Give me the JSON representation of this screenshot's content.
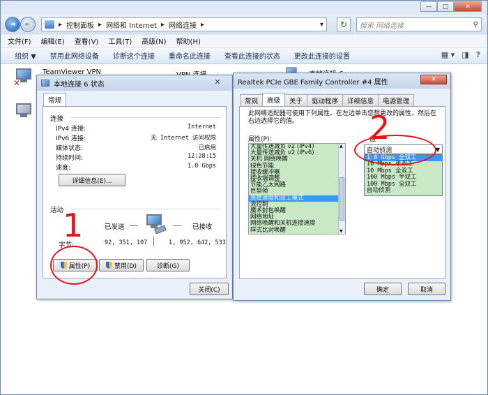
{
  "explorer": {
    "nav_back": "◄",
    "nav_forward": "►",
    "breadcrumb": [
      "控制面板",
      "网络和 Internet",
      "网络连接"
    ],
    "refresh_glyph": "↻",
    "search_placeholder": "搜索 网络连接",
    "menu": [
      "文件(F)",
      "编辑(E)",
      "查看(V)",
      "工具(T)",
      "高级(N)",
      "帮助(H)"
    ],
    "toolbar": [
      "组织 ▼",
      "禁用此网络设备",
      "诊断这个连接",
      "重命名此连接",
      "查看此连接的状态",
      "更改此连接的设置"
    ],
    "items": [
      {
        "name": "TeamViewer VPN"
      },
      {
        "name": "VPN 连接"
      },
      {
        "name": "本地连接 6"
      }
    ],
    "caption": {
      "min": "—",
      "max": "□",
      "close": "✕"
    }
  },
  "status_dialog": {
    "title": "本地连接 6 状态",
    "close": "✕",
    "tab": "常规",
    "connection_label": "连接",
    "rows": [
      {
        "label": "IPv4 连接:",
        "value": "Internet"
      },
      {
        "label": "IPv6 连接:",
        "value": "无 Internet 访问权限"
      },
      {
        "label": "媒体状态:",
        "value": "已启用"
      },
      {
        "label": "持续时间:",
        "value": "12:28:15"
      },
      {
        "label": "速度:",
        "value": "1.0 Gbps"
      }
    ],
    "details_button": "详细信息(E)...",
    "activity_label": "活动",
    "sent_label": "已发送",
    "received_label": "已接收",
    "bytes_label": "字节:",
    "bytes_sent": "92, 351, 107",
    "bytes_received": "1, 952, 642, 533",
    "properties_button": "属性(P)",
    "disable_button": "禁用(D)",
    "diagnose_button": "诊断(G)",
    "close_button": "关闭(C)"
  },
  "props_dialog": {
    "title": "Realtek PCIe GBE Family Controller #4 属性",
    "close": "✕",
    "tabs": [
      "常规",
      "高级",
      "关于",
      "驱动程序",
      "详细信息",
      "电源管理"
    ],
    "active_tab": 1,
    "description": "此网络适配器可使用下列属性。在左边单击您想更改的属性，然后在右边选择它的值。",
    "property_label": "属性(P):",
    "value_label": "值",
    "properties": [
      "大量传送减负 v2 (IPv4)",
      "大量传送减负 v2 (IPv6)",
      "关机 网络唤醒",
      "绿色节能",
      "接收缓冲器",
      "接收端调整",
      "节能乙太网路",
      "巨型帧",
      "连接速度和双工模式",
      "流控制",
      "魔术封包唤醒",
      "网络地址",
      "网络唤醒和关机连接速度",
      "样式比对唤醒"
    ],
    "selected_property": 8,
    "value_selected": "自动侦测",
    "value_options": [
      "1.0 Gbps 全双工",
      "10 Mbps 半双工",
      "10 Mbps 全双工",
      "100 Mbps 半双工",
      "100 Mbps 全双工",
      "自动侦测"
    ],
    "highlighted_option": 0,
    "ok_button": "确定",
    "cancel_button": "取消"
  },
  "annotations": {
    "one": "1",
    "two": "2",
    "color": "#e4131b"
  }
}
